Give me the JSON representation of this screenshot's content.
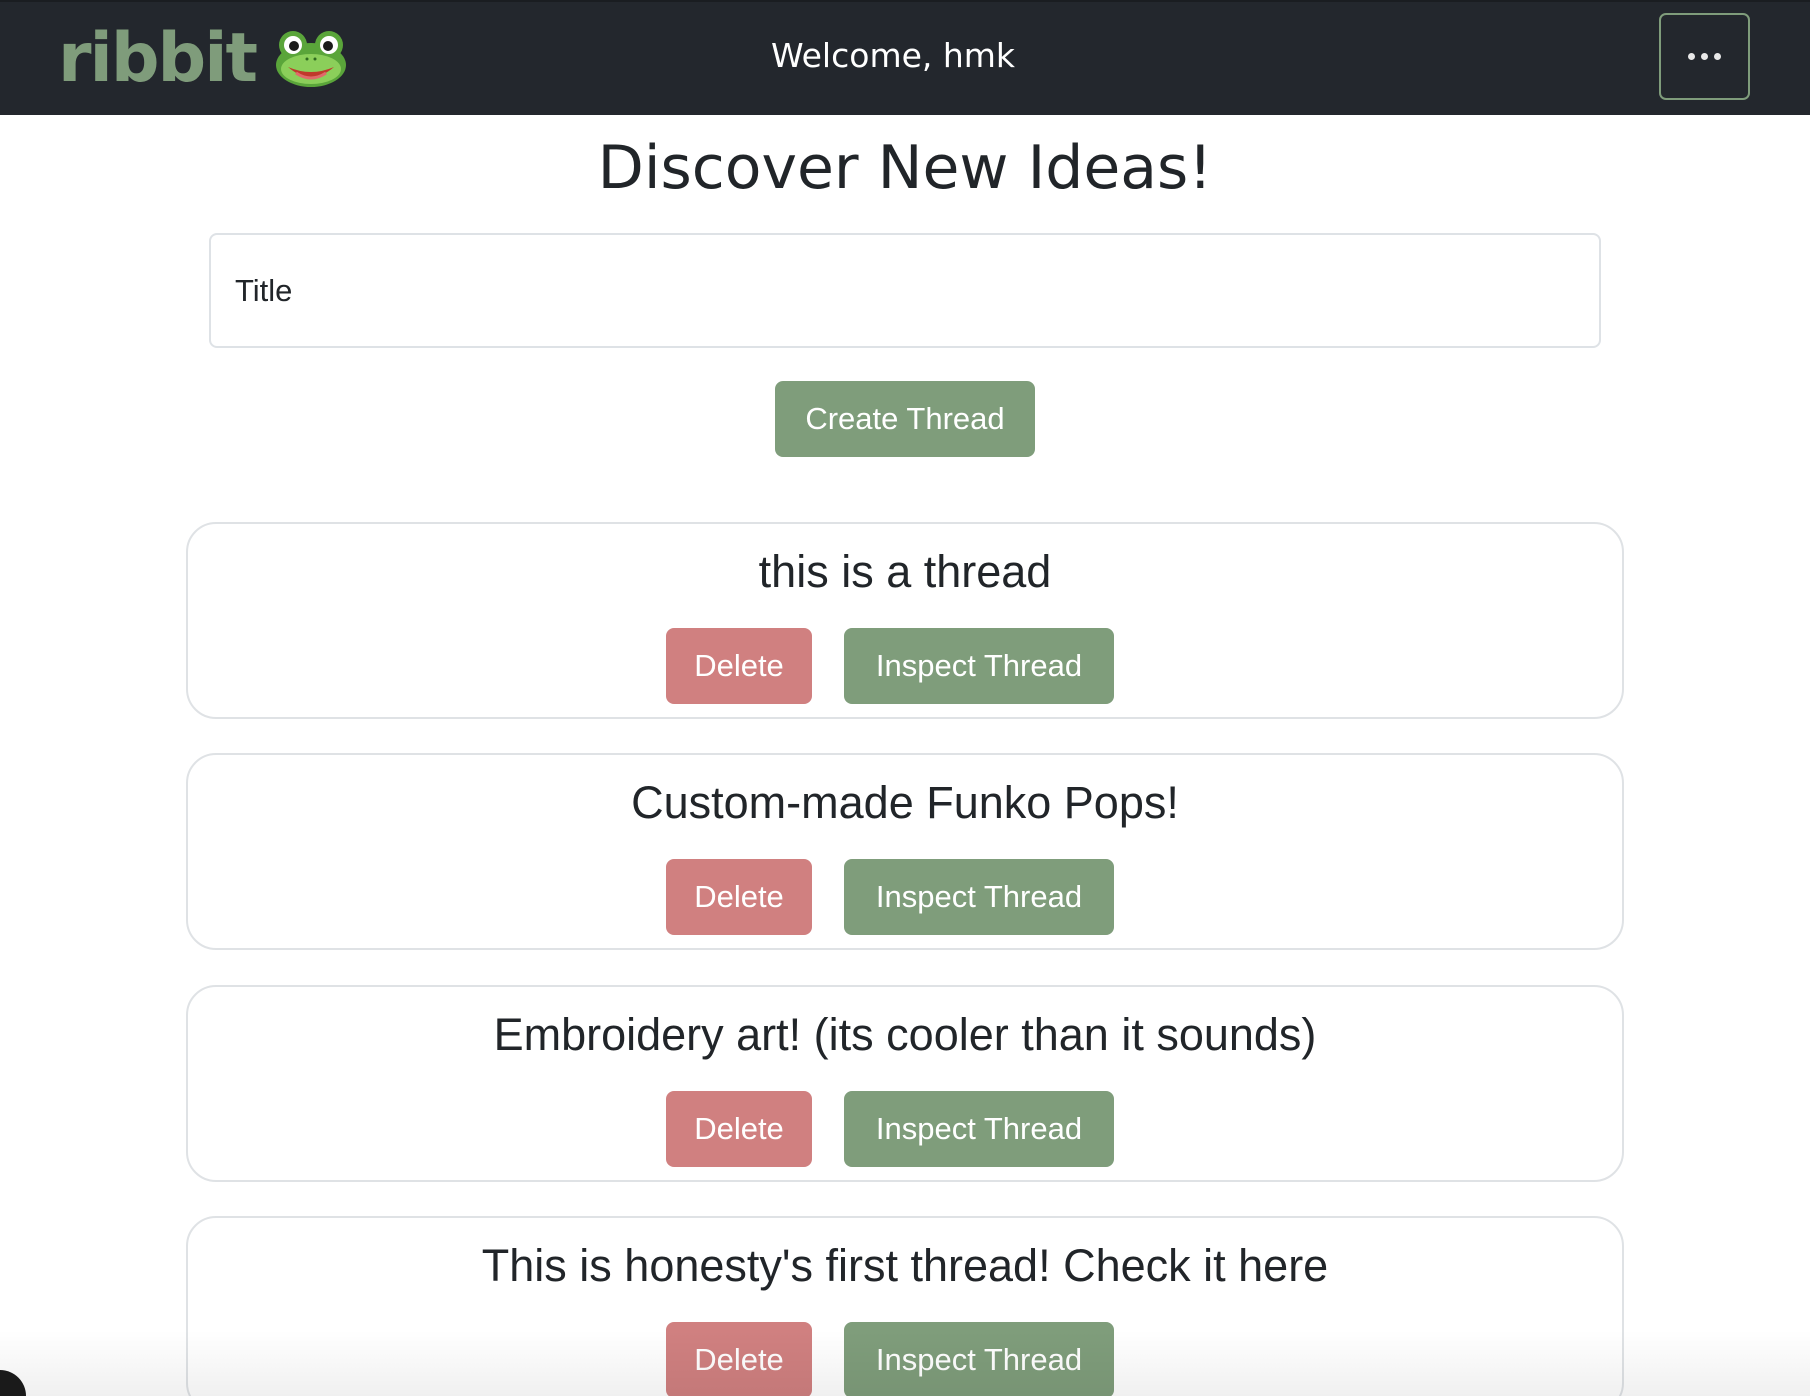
{
  "navbar": {
    "brand_text": "ribbit",
    "brand_icon": "frog-face-icon",
    "welcome_text": "Welcome, hmk",
    "menu_icon": "more-horizontal-icon"
  },
  "main": {
    "heading": "Discover New Ideas!",
    "title_input": {
      "placeholder": "Title",
      "value": ""
    },
    "create_button_label": "Create Thread"
  },
  "threads": [
    {
      "title": "this is a thread",
      "delete_label": "Delete",
      "inspect_label": "Inspect Thread"
    },
    {
      "title": "Custom-made Funko Pops!",
      "delete_label": "Delete",
      "inspect_label": "Inspect Thread"
    },
    {
      "title": "Embroidery art! (its cooler than it sounds)",
      "delete_label": "Delete",
      "inspect_label": "Inspect Thread"
    },
    {
      "title": "This is honesty's first thread! Check it here",
      "delete_label": "Delete",
      "inspect_label": "Inspect Thread"
    }
  ],
  "colors": {
    "navbar_bg": "#23272d",
    "brand_green": "#7f9c7b",
    "button_green": "#7f9d7b",
    "button_red": "#d08080",
    "text_dark": "#212529"
  }
}
